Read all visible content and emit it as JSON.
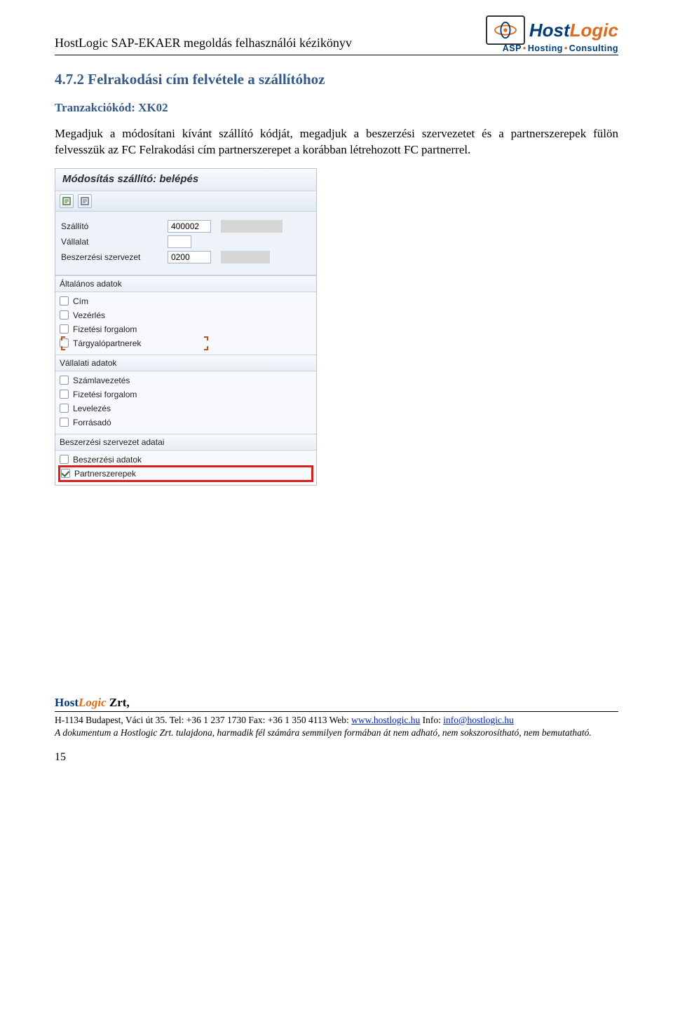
{
  "doc": {
    "header_title": "HostLogic SAP-EKAER megoldás felhasználói kézikönyv"
  },
  "logo": {
    "host": "Host",
    "logic": "Logic",
    "sub_asp": "ASP",
    "sub_hosting": "Hosting",
    "sub_consulting": "Consulting"
  },
  "section": {
    "heading": "4.7.2 Felrakodási cím felvétele a szállítóhoz",
    "trans_label": "Tranzakciókód: XK02",
    "body": "Megadjuk a módosítani kívánt szállító kódját, megadjuk a beszerzési szervezetet és a partnerszerepek fülön felvesszük az FC Felrakodási cím partnerszerepet a korábban létrehozott FC partnerrel."
  },
  "sap": {
    "title": "Módosítás szállító: belépés",
    "fields": {
      "szallito_label": "Szállító",
      "szallito_value": "400002",
      "vallalat_label": "Vállalat",
      "vallalat_value": "",
      "besz_label": "Beszerzési szervezet",
      "besz_value": "0200"
    },
    "groups": {
      "general": {
        "title": "Általános adatok",
        "items": {
          "cim": "Cím",
          "vezerles": "Vezérlés",
          "fiz": "Fizetési forgalom",
          "targy": "Tárgyalópartnerek"
        }
      },
      "company": {
        "title": "Vállalati adatok",
        "items": {
          "szamla": "Számlavezetés",
          "fiz": "Fizetési forgalom",
          "lvl": "Levelezés",
          "forr": "Forrásadó"
        }
      },
      "purchorg": {
        "title": "Beszerzési szervezet adatai",
        "items": {
          "besz": "Beszerzési adatok",
          "part": "Partnerszerepek"
        }
      }
    }
  },
  "footer": {
    "brand_host": "Host",
    "brand_logic": "Logic",
    "brand_zrt": " Zrt,",
    "address_prefix": "H-1134 Budapest, Váci út 35. Tel: +36 1 237 1730 Fax: +36 1 350 4113 Web: ",
    "web": "www.hostlogic.hu",
    "info_label": " Info: ",
    "email": "info@hostlogic.hu",
    "disclaimer": "A dokumentum a Hostlogic Zrt. tulajdona, harmadik fél számára semmilyen formában át nem adható, nem sokszorosítható, nem bemutatható.",
    "page": "15"
  }
}
